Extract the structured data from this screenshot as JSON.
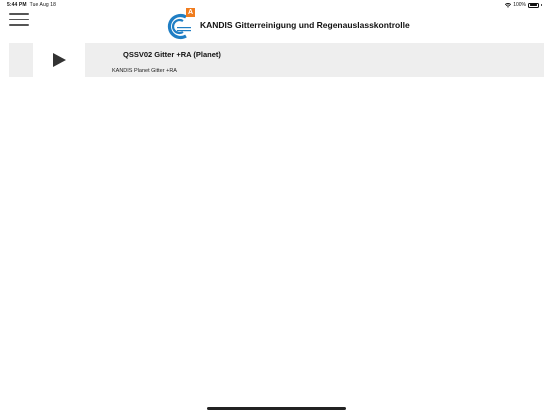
{
  "status_bar": {
    "time": "5:44 PM",
    "date": "Tue Aug 18",
    "battery": "100%",
    "icons": [
      "wifi-icon",
      "battery-icon"
    ]
  },
  "header": {
    "menu_icon": "hamburger-menu-icon",
    "logo_badge": "A",
    "title": "KANDIS Gitterreinigung und Regenauslasskontrolle"
  },
  "items": [
    {
      "title": "QSSV02 Gitter +RA (Planet)",
      "subtitle": "KANDIS Planet Gitter +RA",
      "icon": "play-icon"
    }
  ],
  "colors": {
    "accent_orange": "#f07c1e",
    "logo_blue": "#1f7ec4",
    "card_bg": "#eeeeee"
  }
}
